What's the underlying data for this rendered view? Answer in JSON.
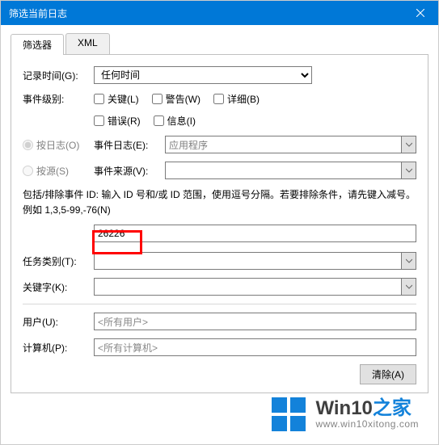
{
  "titlebar": {
    "title": "筛选当前日志"
  },
  "tabs": {
    "filter": "筛选器",
    "xml": "XML"
  },
  "labels": {
    "logged": "记录时间(G):",
    "level": "事件级别:",
    "by_log": "按日志(O)",
    "by_source": "按源(S)",
    "event_log": "事件日志(E):",
    "event_source": "事件来源(V):",
    "help_text": "包括/排除事件 ID: 输入 ID 号和/或 ID 范围，使用逗号分隔。若要排除条件，请先键入减号。例如 1,3,5-99,-76(N)",
    "task_category": "任务类别(T):",
    "keywords": "关键字(K):",
    "user": "用户(U):",
    "computer": "计算机(P):"
  },
  "values": {
    "logged": "任何时间",
    "event_log": "应用程序",
    "event_id": "26226",
    "user": "<所有用户>",
    "computer": "<所有计算机>"
  },
  "checks": {
    "critical": "关键(L)",
    "warning": "警告(W)",
    "verbose": "详细(B)",
    "error": "错误(R)",
    "info": "信息(I)"
  },
  "buttons": {
    "clear": "清除(A)"
  },
  "watermark": {
    "main_pre": "Win10",
    "main_post": "之家",
    "url": "www.win10xitong.com"
  }
}
